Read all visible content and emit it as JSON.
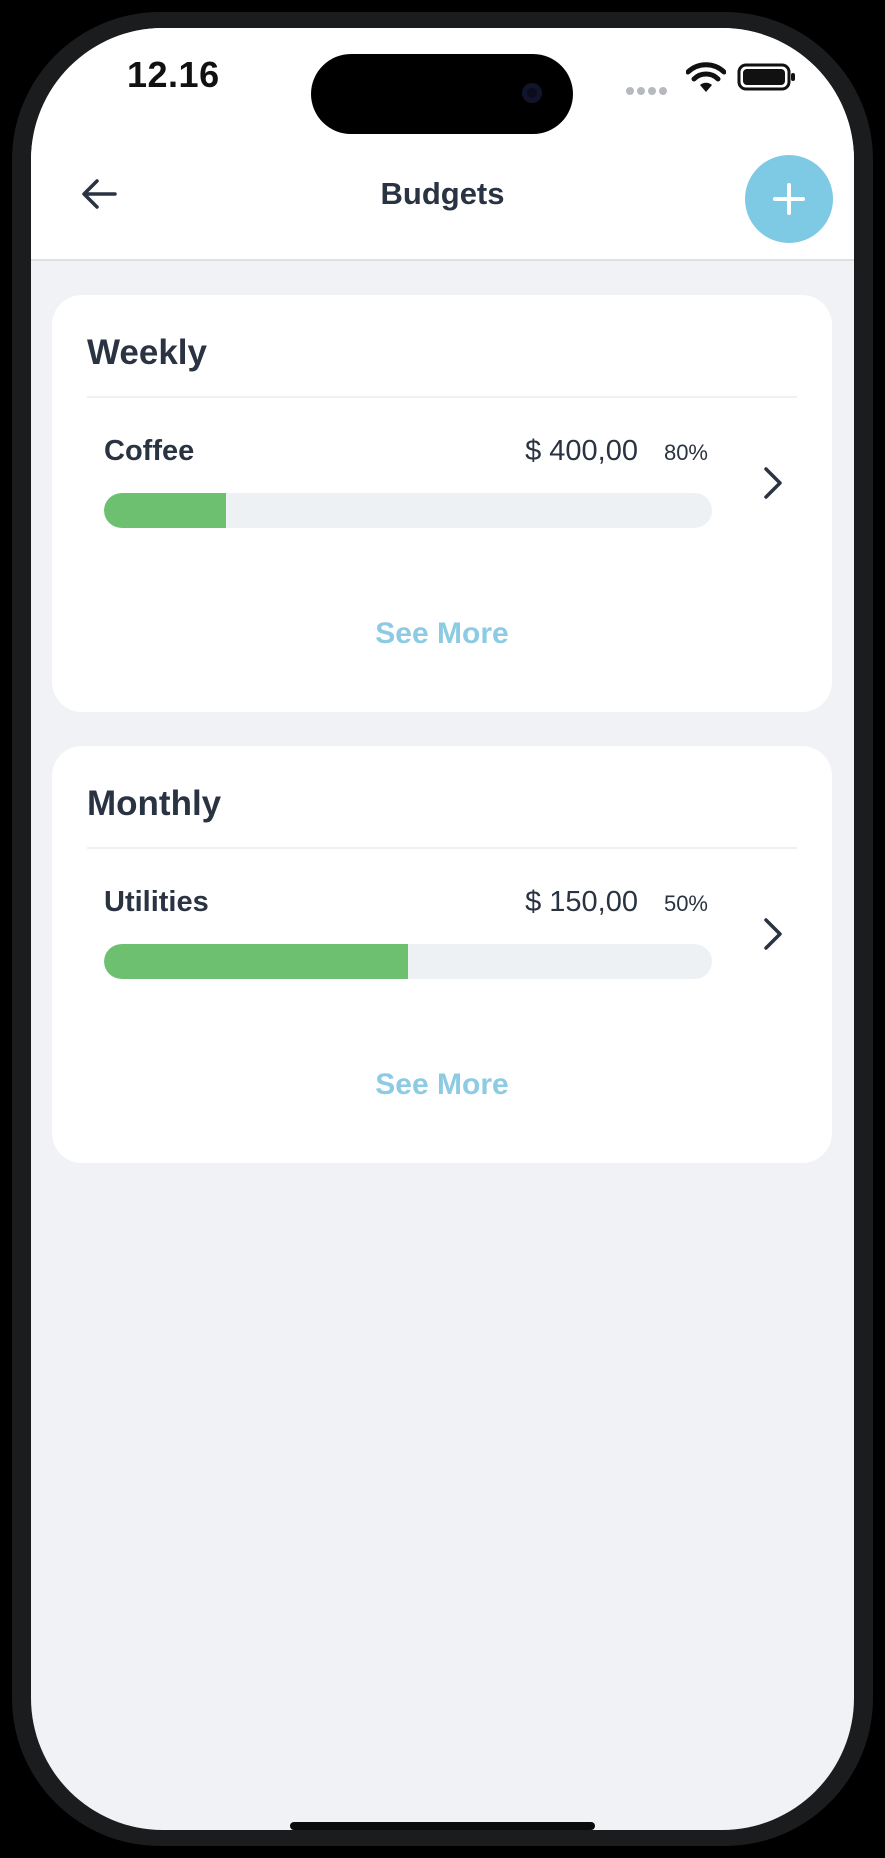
{
  "status_bar": {
    "time": "12.16"
  },
  "header": {
    "title": "Budgets"
  },
  "colors": {
    "accent": "#7ecae4",
    "progress_fill": "#6cc06f",
    "progress_track": "#eef1f4",
    "see_more": "#8ccbe3",
    "text_primary": "#2a3342"
  },
  "icons": {
    "back": "arrow-left-icon",
    "add": "plus-icon",
    "item_chevron": "chevron-right-icon",
    "wifi": "wifi-icon",
    "battery": "battery-icon",
    "signal": "signal-icon"
  },
  "sections": [
    {
      "title": "Weekly",
      "items": [
        {
          "name": "Coffee",
          "amount": "$ 400,00",
          "percent": "80%",
          "progress": 0.2
        }
      ],
      "see_more": "See More"
    },
    {
      "title": "Monthly",
      "items": [
        {
          "name": "Utilities",
          "amount": "$ 150,00",
          "percent": "50%",
          "progress": 0.5
        }
      ],
      "see_more": "See More"
    }
  ]
}
